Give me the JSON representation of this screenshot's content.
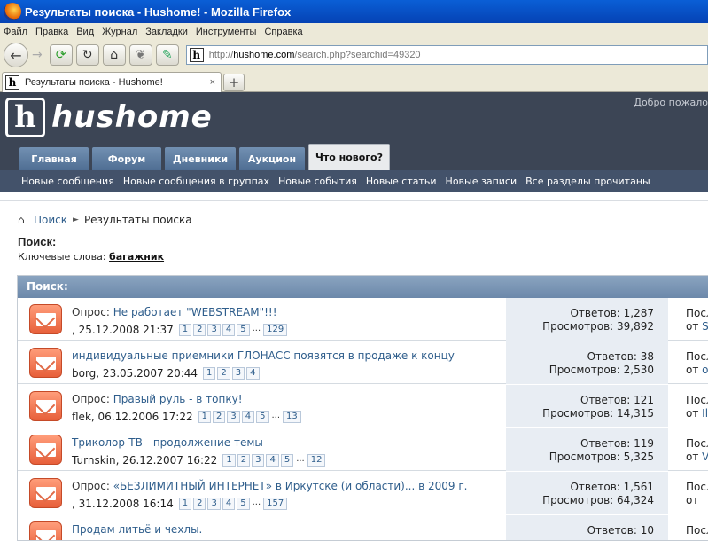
{
  "window": {
    "title": "Результаты поиска - Hushome! - Mozilla Firefox"
  },
  "menu": [
    "Файл",
    "Правка",
    "Вид",
    "Журнал",
    "Закладки",
    "Инструменты",
    "Справка"
  ],
  "url": {
    "prefix": "http://",
    "host": "hushome.com",
    "path": "/search.php?searchid=49320"
  },
  "tab": {
    "title": "Результаты поиска - Hushome!",
    "close": "×",
    "new": "+"
  },
  "site": {
    "logo_letter": "h",
    "logo_text": "hushome",
    "welcome": "Добро пожало"
  },
  "nav": {
    "tabs": [
      "Главная",
      "Форум",
      "Дневники",
      "Аукцион",
      "Что нового?"
    ],
    "active": "Что нового?",
    "sub": [
      "Новые сообщения",
      "Новые сообщения в группах",
      "Новые события",
      "Новые статьи",
      "Новые записи",
      "Все разделы прочитаны"
    ]
  },
  "breadcrumb": {
    "search": "Поиск",
    "current": "Результаты поиска"
  },
  "page": {
    "title": "Поиск:",
    "keywords_label": "Ключевые слова:",
    "keywords_value": "багажник"
  },
  "panel": {
    "title": "Поиск:"
  },
  "threads": [
    {
      "prefix": "Опрос: ",
      "title": "Не работает \"WEBSTREAM\"!!!",
      "meta": ", 25.12.2008 21:37",
      "pages": [
        "1",
        "2",
        "3",
        "4",
        "5",
        "...",
        "129"
      ],
      "replies": "Ответов: 1,287",
      "views": "Просмотров: 39,892",
      "last1": "Посл",
      "last2_pre": "от ",
      "last2_user": "S"
    },
    {
      "prefix": "",
      "title": "индивидуальные приемники ГЛОНАСС появятся в продаже к концу",
      "meta": "borg, 23.05.2007 20:44",
      "pages": [
        "1",
        "2",
        "3",
        "4"
      ],
      "replies": "Ответов: 38",
      "views": "Просмотров: 2,530",
      "last1": "Посл",
      "last2_pre": "от ",
      "last2_user": "о"
    },
    {
      "prefix": "Опрос: ",
      "title": "Правый руль - в топку!",
      "meta": "flek, 06.12.2006 17:22",
      "pages": [
        "1",
        "2",
        "3",
        "4",
        "5",
        "...",
        "13"
      ],
      "replies": "Ответов: 121",
      "views": "Просмотров: 14,315",
      "last1": "Посл",
      "last2_pre": "от ",
      "last2_user": "Ily"
    },
    {
      "prefix": "",
      "title": "Триколор-ТВ - продолжение темы",
      "meta": "Turnskin, 26.12.2007 16:22",
      "pages": [
        "1",
        "2",
        "3",
        "4",
        "5",
        "...",
        "12"
      ],
      "replies": "Ответов: 119",
      "views": "Просмотров: 5,325",
      "last1": "Посл",
      "last2_pre": "от ",
      "last2_user": "V"
    },
    {
      "prefix": "Опрос: ",
      "title": "«БЕЗЛИМИТНЫЙ ИНТЕРНЕТ» в Иркутске (и области)... в 2009 г.",
      "meta": ", 31.12.2008 16:14",
      "pages": [
        "1",
        "2",
        "3",
        "4",
        "5",
        "...",
        "157"
      ],
      "replies": "Ответов: 1,561",
      "views": "Просмотров: 64,324",
      "last1": "Посл",
      "last2_pre": "от ",
      "last2_user": ""
    },
    {
      "prefix": "",
      "title": "Продам литьё и чехлы.",
      "meta": "",
      "pages": [],
      "replies": "Ответов: 10",
      "views": "",
      "last1": "Посл",
      "last2_pre": "",
      "last2_user": ""
    }
  ]
}
